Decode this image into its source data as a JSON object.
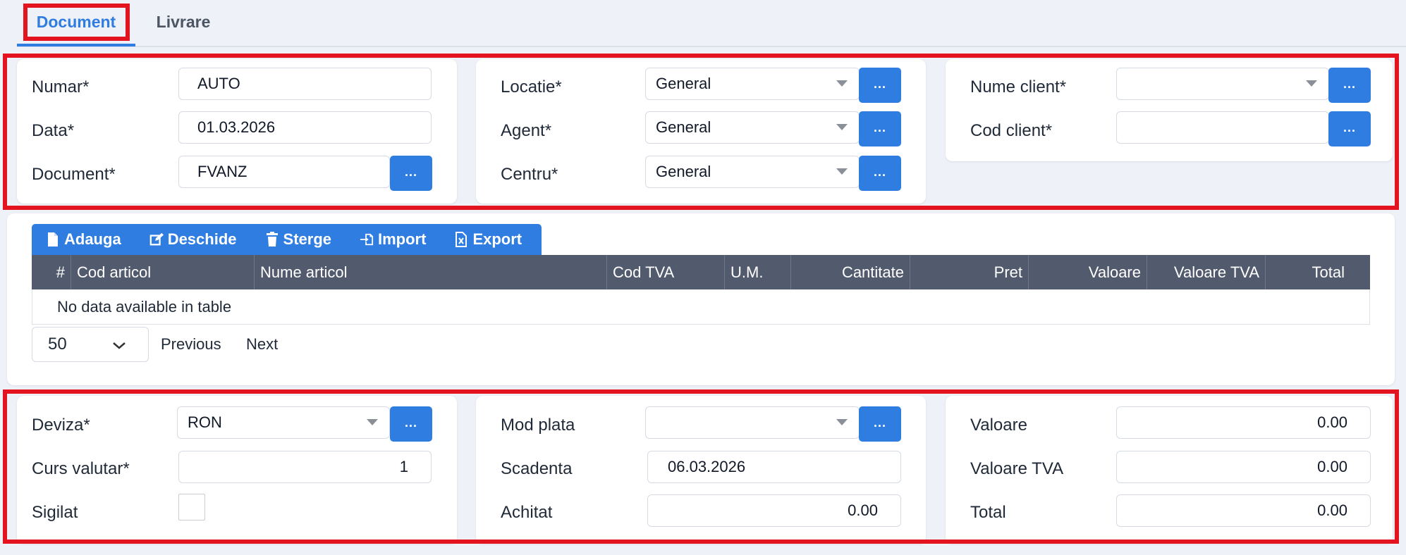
{
  "tabs": [
    {
      "label": "Document",
      "active": true
    },
    {
      "label": "Livrare",
      "active": false
    }
  ],
  "document": {
    "numar": {
      "label": "Numar*",
      "value": "AUTO"
    },
    "data": {
      "label": "Data*",
      "value": "01.03.2026"
    },
    "document": {
      "label": "Document*",
      "value": "FVANZ"
    },
    "dots": "..."
  },
  "org": {
    "locatie": {
      "label": "Locatie*",
      "value": "General"
    },
    "agent": {
      "label": "Agent*",
      "value": "General"
    },
    "centru": {
      "label": "Centru*",
      "value": "General"
    },
    "dots": "..."
  },
  "client": {
    "nume": {
      "label": "Nume client*",
      "value": ""
    },
    "cod": {
      "label": "Cod client*",
      "value": ""
    },
    "dots": "..."
  },
  "toolbar": {
    "add": "Adauga",
    "open": "Deschide",
    "delete": "Sterge",
    "import": "Import",
    "export": "Export"
  },
  "table": {
    "columns": [
      "#",
      "Cod articol",
      "Nume articol",
      "Cod TVA",
      "U.M.",
      "Cantitate",
      "Pret",
      "Valoare",
      "Valoare TVA",
      "Total"
    ],
    "empty": "No data available in table"
  },
  "pager": {
    "page_size": "50",
    "previous": "Previous",
    "next": "Next"
  },
  "currency": {
    "deviza": {
      "label": "Deviza*",
      "value": "RON"
    },
    "curs": {
      "label": "Curs valutar*",
      "value": "1"
    },
    "sigilat": {
      "label": "Sigilat",
      "checked": false
    },
    "dots": "..."
  },
  "payment": {
    "mod": {
      "label": "Mod plata",
      "value": ""
    },
    "scadenta": {
      "label": "Scadenta",
      "value": "06.03.2026"
    },
    "achitat": {
      "label": "Achitat",
      "value": "0.00"
    },
    "dots": "..."
  },
  "totals": {
    "valoare": {
      "label": "Valoare",
      "value": "0.00"
    },
    "valoare_tva": {
      "label": "Valoare TVA",
      "value": "0.00"
    },
    "total": {
      "label": "Total",
      "value": "0.00"
    }
  },
  "colors": {
    "accent": "#2f7de1",
    "highlight": "#e3131f",
    "table_header": "#525a6d"
  }
}
